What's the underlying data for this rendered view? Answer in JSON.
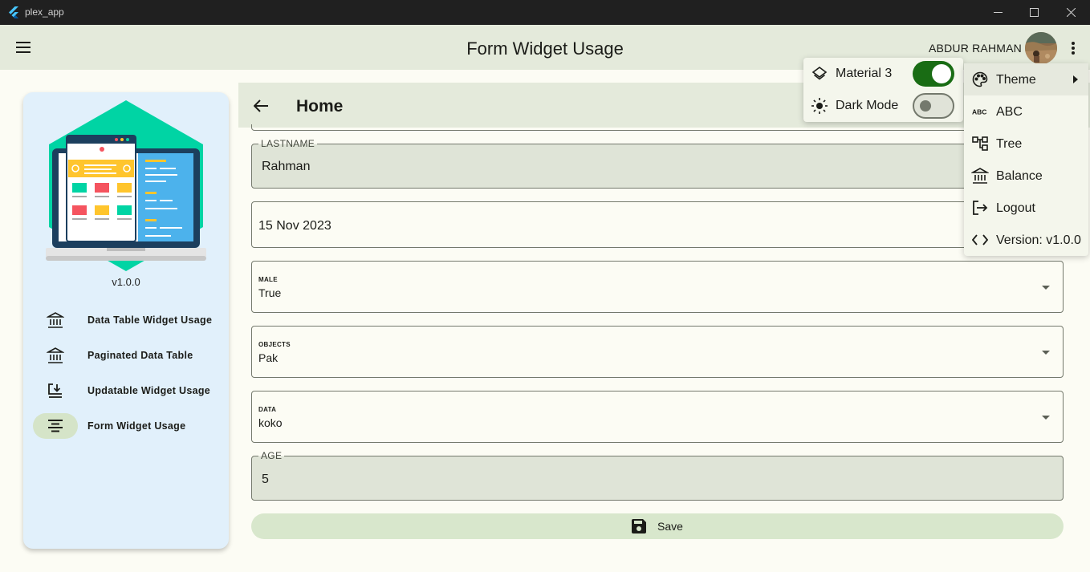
{
  "window": {
    "app_name": "plex_app"
  },
  "appbar": {
    "title": "Form Widget Usage",
    "user_name": "ABDUR RAHMAN"
  },
  "sidenav": {
    "version": "v1.0.0",
    "items": [
      {
        "label": "Data Table Widget Usage",
        "icon": "bank-icon"
      },
      {
        "label": "Paginated Data Table",
        "icon": "bank-icon"
      },
      {
        "label": "Updatable Widget Usage",
        "icon": "download-to-screen-icon"
      },
      {
        "label": "Form Widget Usage",
        "icon": "align-center-icon",
        "active": true
      }
    ]
  },
  "page": {
    "title": "Home"
  },
  "form": {
    "lastname": {
      "label": "LASTNAME",
      "value": "Rahman"
    },
    "date": {
      "value": "15 Nov 2023"
    },
    "male": {
      "label": "MALE",
      "value": "True"
    },
    "objects": {
      "label": "OBJECTS",
      "value": "Pak"
    },
    "data": {
      "label": "DATA",
      "value": "koko"
    },
    "age": {
      "label": "AGE",
      "value": "5"
    },
    "save_label": "Save"
  },
  "theme_submenu": {
    "material3": {
      "label": "Material 3",
      "on": true
    },
    "dark_mode": {
      "label": "Dark Mode",
      "on": false
    }
  },
  "menu": {
    "items": [
      {
        "label": "Theme",
        "icon": "palette-icon",
        "has_submenu": true
      },
      {
        "label": "ABC",
        "icon": "abc-icon"
      },
      {
        "label": "Tree",
        "icon": "account-tree-icon"
      },
      {
        "label": "Balance",
        "icon": "bank-icon"
      },
      {
        "label": "Logout",
        "icon": "logout-icon"
      },
      {
        "label": "Version: v1.0.0",
        "icon": "code-icon"
      }
    ]
  },
  "colors": {
    "primary": "#196c14",
    "appbar_bg": "#e4eadb",
    "sidenav_bg": "#e1f0fb",
    "button_bg": "#d8e7cc"
  }
}
